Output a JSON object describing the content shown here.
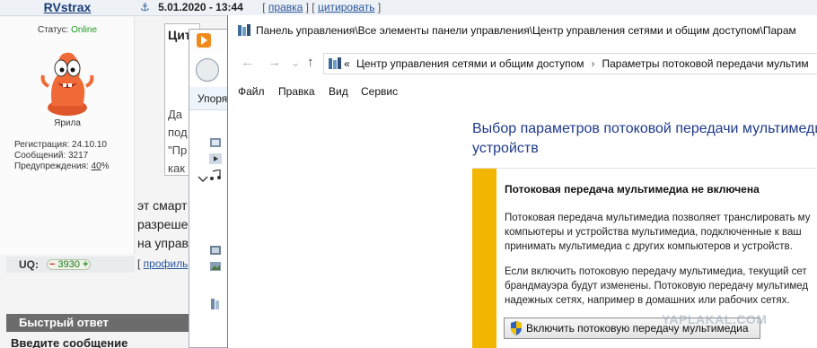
{
  "forum": {
    "username": "RVstrax",
    "post_date": "5.01.2020 - 13:44",
    "anchor_glyph": "⚓",
    "edit_link": "правка",
    "quote_link": "цитировать",
    "status_label": "Статус: ",
    "status_value": "Online",
    "rank": "Ярила",
    "registration": "Регистрация: 24.10.10",
    "messages": "Сообщений: 3217",
    "warnings_label": "Предупреждения: ",
    "warnings_value": "40",
    "warnings_suffix": "%",
    "uq_label": "UQ:",
    "uq_minus": "−",
    "uq_value": "3930",
    "uq_plus": "+",
    "cite_title": "Цит",
    "cite_lines": [
      "Да",
      "под",
      "\"Пр",
      "как"
    ],
    "post_lines": [
      "эт смарт",
      "разреше",
      "на управ"
    ],
    "profile_link": "профиль",
    "quick_reply": "Быстрый ответ",
    "enter_message": "Введите сообщение"
  },
  "explorer": {
    "tab_label": "Упоряд"
  },
  "control_panel": {
    "title": "Панель управления\\Все элементы панели управления\\Центр управления сетями и общим доступом\\Парам",
    "address_chevron": "«",
    "address_part1": "Центр управления сетями и общим доступом",
    "address_sep": "›",
    "address_part2": "Параметры потоковой передачи мультим",
    "menu": [
      "Файл",
      "Правка",
      "Вид",
      "Сервис"
    ],
    "heading": "Выбор параметров потоковой передачи мультимедиа устройств",
    "panel_title": "Потоковая передача мультимедиа не включена",
    "panel_p1": "Потоковая передача мультимедиа позволяет транслировать му\nкомпьютеры и устройства мультимедиа, подключенные к ваш\nпринимать мультимедиа с других компьютеров и устройств.",
    "panel_p2": "Если включить потоковую передачу мультимедиа, текущий сет\nбрандмауэра будут изменены. Потоковую передачу мультимед\nнадежных сетях, например в домашних или рабочих сетях.",
    "enable_button": "Включить потоковую передачу мультимедиа",
    "nav_back": "←",
    "nav_forward": "→",
    "nav_recent": "⌄",
    "nav_up": "↑"
  },
  "watermark": "YAPLAKAL.COM",
  "colors": {
    "accent_stripe": "#f2b600",
    "heading_blue": "#1e3a8a",
    "online_green": "#1c9c1c",
    "quick_reply_bg": "#6c6c6c"
  }
}
